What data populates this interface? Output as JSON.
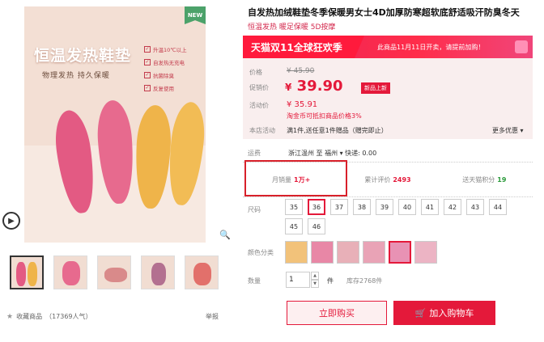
{
  "gallery": {
    "new_badge": "NEW",
    "promo_title": "恒温发热鞋垫",
    "promo_subtitle": "物理发热 持久保暖",
    "features": [
      "升温10℃以上",
      "自发热无充电",
      "抗菌除臭",
      "反复使用"
    ],
    "thumbnails": [
      "thumb-1",
      "thumb-2",
      "thumb-3",
      "thumb-4",
      "thumb-5"
    ],
    "favorite_label": "收藏商品",
    "favorite_count": "（17369人气）",
    "report_label": "举报"
  },
  "product": {
    "title": "自发热加绒鞋垫冬季保暖男女士4D加厚防寒超软底舒适吸汗防臭冬天",
    "subtitle": "恒温发热 暖足保暖 5D按摩"
  },
  "banner": {
    "main": "天猫双11全球狂欢季",
    "note": "此商品11月11日开卖，请提前加购！"
  },
  "price": {
    "original_label": "价格",
    "original_value": "¥ 45.90",
    "current_label": "促销价",
    "currency": "¥",
    "current_value": "39.90",
    "current_tag": "新品上新",
    "activity_label": "活动价",
    "activity_value": "¥ 35.91",
    "coin_note": "淘金币可抵扣商品价格3%",
    "store_label": "本店活动",
    "store_value": "满1件,送任意1件赠品（赠完即止）",
    "more_label": "更多优惠 ▾"
  },
  "shipping": {
    "label": "运费",
    "route": "浙江温州 至 福州 ▾ 快递: 0.00"
  },
  "stats": {
    "sales_label": "月销量",
    "sales_value": "1万+",
    "reviews_label": "累计评价",
    "reviews_value": "2493",
    "points_label": "送天猫积分",
    "points_value": "19"
  },
  "size": {
    "label": "尺码",
    "options": [
      "35",
      "36",
      "37",
      "38",
      "39",
      "40",
      "41",
      "42",
      "43",
      "44",
      "45",
      "46"
    ],
    "selected": "36"
  },
  "color": {
    "label": "颜色分类",
    "swatches": [
      "#f2c27a",
      "#e887a6",
      "#e8b0b8",
      "#e9a3b6",
      "#e892b4",
      "#ecb4c4"
    ]
  },
  "quantity": {
    "label": "数量",
    "value": "1",
    "unit": "件",
    "stock": "库存2768件"
  },
  "actions": {
    "buy_now": "立即购买",
    "add_cart": "加入购物车"
  },
  "colors": {
    "accent": "#e4193a",
    "highlight_box": "#d8202a"
  }
}
